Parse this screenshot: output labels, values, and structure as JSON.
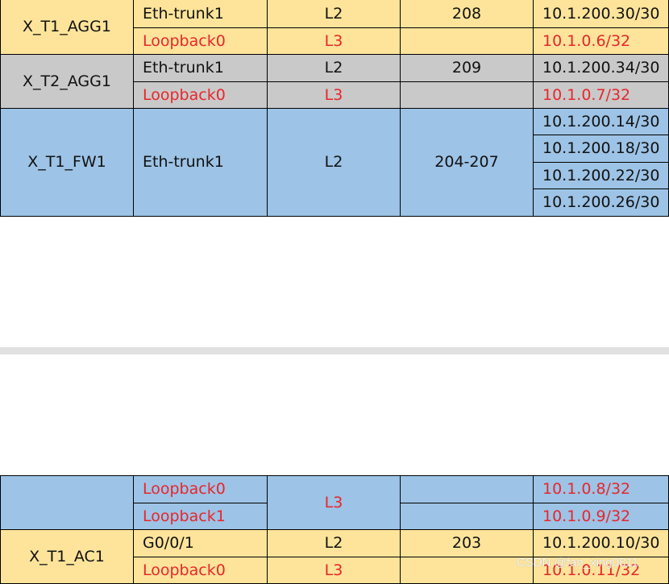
{
  "table_top": {
    "rows": [
      {
        "device": "X_T1_AGG1",
        "interface": "Eth-trunk1",
        "layer": "L2",
        "vlan": "208",
        "ip": "10.1.200.30/30"
      },
      {
        "interface": "Loopback0",
        "layer": "L3",
        "vlan": "",
        "ip": "10.1.0.6/32"
      },
      {
        "device": "X_T2_AGG1",
        "interface": "Eth-trunk1",
        "layer": "L2",
        "vlan": "209",
        "ip": "10.1.200.34/30"
      },
      {
        "interface": "Loopback0",
        "layer": "L3",
        "vlan": "",
        "ip": "10.1.0.7/32"
      },
      {
        "device": "X_T1_FW1",
        "interface": "Eth-trunk1",
        "layer": "L2",
        "vlan": "204-207",
        "ips": [
          "10.1.200.14/30",
          "10.1.200.18/30",
          "10.1.200.22/30",
          "10.1.200.26/30"
        ]
      }
    ]
  },
  "table_bottom": {
    "rows": [
      {
        "device": "",
        "interface": "Loopback0",
        "layer": "L3",
        "vlan": "",
        "ip": "10.1.0.8/32"
      },
      {
        "interface": "Loopback1",
        "vlan": "",
        "ip": "10.1.0.9/32"
      },
      {
        "device": "X_T1_AC1",
        "interface": "G0/0/1",
        "layer": "L2",
        "vlan": "203",
        "ip": "10.1.200.10/30"
      },
      {
        "interface": "Loopback0",
        "layer": "L3",
        "vlan": "",
        "ip": "10.1.0.11/32"
      }
    ]
  },
  "watermark": "CSDN @fan_xing0811",
  "colors": {
    "yellow": "#fde49a",
    "gray": "#c9c9c9",
    "blue": "#9dc3e6",
    "red_text": "#e8262b",
    "divider": "#e1e1e1"
  }
}
